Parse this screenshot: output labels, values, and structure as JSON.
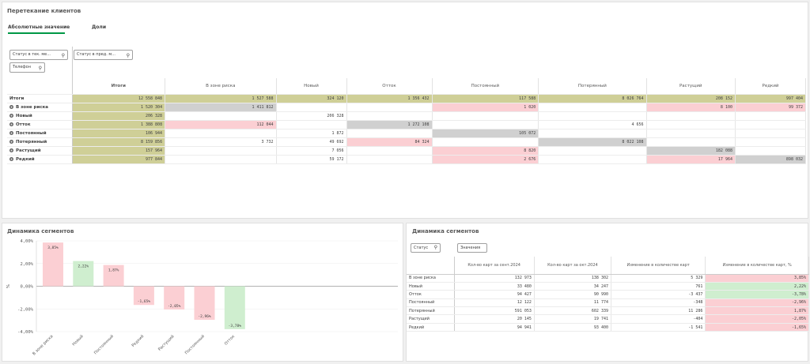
{
  "top": {
    "title": "Перетекание клиентов",
    "tabs": [
      "Абсолютные значение",
      "Доли"
    ],
    "filters": {
      "status_current": "Статус в тек. ме...",
      "status_prev": "Статус в пред. м...",
      "phone": "Телефон"
    },
    "pivot": {
      "columns": [
        "Итоги",
        "В зоне риска",
        "Новый",
        "Отток",
        "Постоянный",
        "Потерянный",
        "Растущий",
        "Редкий"
      ],
      "totals_label": "Итоги",
      "totals": [
        "12 558 848",
        "1 527 588",
        "324 120",
        "1 356 432",
        "117 588",
        "8 026 764",
        "208 152",
        "997 404"
      ],
      "rows": [
        {
          "label": "В зоне риска",
          "cells": [
            "1 520 304",
            "1 411 812",
            "",
            "",
            "1 020",
            "",
            "8 100",
            "99 372"
          ]
        },
        {
          "label": "Новый",
          "cells": [
            "206 328",
            "",
            "206 328",
            "",
            "",
            "",
            "",
            ""
          ]
        },
        {
          "label": "Отток",
          "cells": [
            "1 388 808",
            "112 044",
            "",
            "1 272 108",
            "",
            "4 656",
            "",
            ""
          ]
        },
        {
          "label": "Постоянный",
          "cells": [
            "106 944",
            "",
            "1 872",
            "",
            "105 072",
            "",
            "",
            ""
          ]
        },
        {
          "label": "Потерянный",
          "cells": [
            "8 159 856",
            "3 732",
            "49 692",
            "84 324",
            "",
            "8 022 108",
            "",
            ""
          ]
        },
        {
          "label": "Растущий",
          "cells": [
            "157 964",
            "",
            "7 056",
            "",
            "8 820",
            "",
            "182 088",
            ""
          ]
        },
        {
          "label": "Редкий",
          "cells": [
            "977 844",
            "",
            "59 172",
            "",
            "2 676",
            "",
            "17 964",
            "898 032"
          ]
        }
      ]
    }
  },
  "left_chart": {
    "title": "Динамика сегментов",
    "ylabel": "%",
    "chart_data": {
      "type": "bar",
      "categories": [
        "В зоне риска",
        "Новый",
        "Постоянный",
        "Редкий",
        "Растущий",
        "Постоянный",
        "Отток"
      ],
      "values": [
        3.85,
        2.22,
        1.87,
        -1.65,
        -2.05,
        -2.96,
        -3.78
      ],
      "value_labels": [
        "3,85%",
        "2,22%",
        "1,87%",
        "-1,65%",
        "-2,05%",
        "-2,96%",
        "-3,78%"
      ],
      "colors": [
        "#fbcfd3",
        "#cfeecf",
        "#fbcfd3",
        "#fbcfd3",
        "#fbcfd3",
        "#fbcfd3",
        "#cfeecf"
      ],
      "yticks": [
        "4,00%",
        "2,00%",
        "0,00%",
        "-2,00%",
        "-4,00%"
      ],
      "ylim": [
        -4,
        4
      ]
    }
  },
  "right_table": {
    "title": "Динамика сегментов",
    "status_label": "Статус",
    "values_label": "Значения",
    "columns": [
      "Кол-во карт за сент.2024",
      "Кол-во карт за окт.2024",
      "Изменение в количестве карт",
      "Изменение в количестве карт, %"
    ],
    "rows": [
      {
        "label": "В зоне риска",
        "cells": [
          "132 973",
          "138 302",
          "5 329",
          "3,85%"
        ],
        "sign": "pos"
      },
      {
        "label": "Новый",
        "cells": [
          "33 480",
          "34 247",
          "761",
          "2,22%"
        ],
        "sign": "neg"
      },
      {
        "label": "Отток",
        "cells": [
          "94 427",
          "90 990",
          "-3 437",
          "-3,78%"
        ],
        "sign": "neg"
      },
      {
        "label": "Постоянный",
        "cells": [
          "12 122",
          "11 774",
          "-348",
          "-2,96%"
        ],
        "sign": "pos"
      },
      {
        "label": "Потерянный",
        "cells": [
          "591 053",
          "602 339",
          "11 286",
          "1,87%"
        ],
        "sign": "pos"
      },
      {
        "label": "Растущий",
        "cells": [
          "20 145",
          "19 741",
          "-404",
          "-2,05%"
        ],
        "sign": "pos"
      },
      {
        "label": "Редкий",
        "cells": [
          "94 941",
          "93 400",
          "-1 541",
          "-1,65%"
        ],
        "sign": "pos"
      }
    ]
  }
}
